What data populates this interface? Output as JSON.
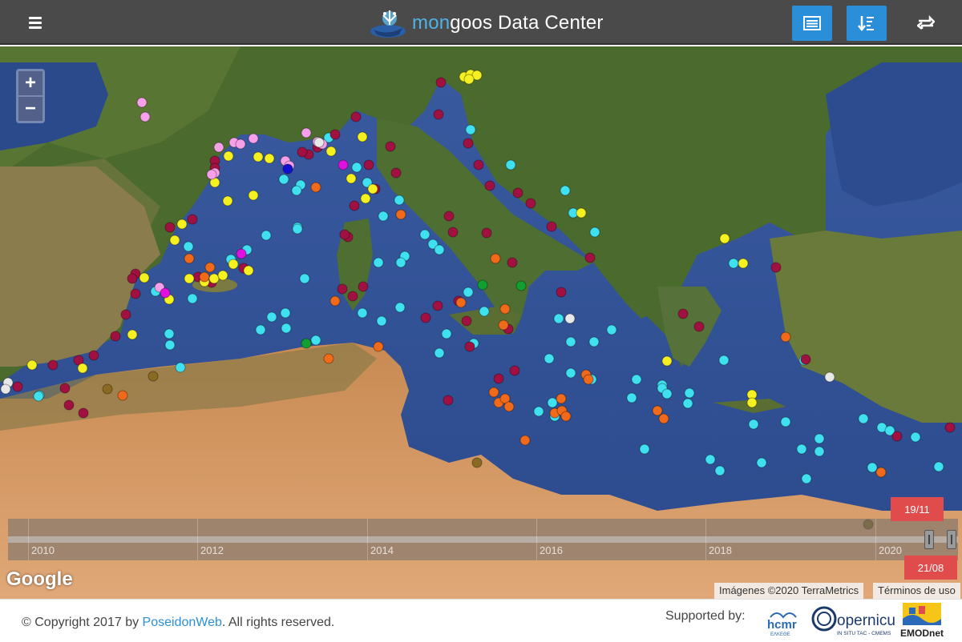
{
  "header": {
    "brand_prefix": "mon",
    "brand_rest": "goos Data Center",
    "menu_icon": "hamburger-icon",
    "btn_list_icon": "list-icon",
    "btn_sort_icon": "sort-icon",
    "btn_swap_icon": "swap-icon",
    "accent": "#2a8fd8"
  },
  "map": {
    "zoom_in": "+",
    "zoom_out": "−",
    "google_logo": "Google",
    "attribution_imagery": "Imágenes ©2020 TerraMetrics",
    "attribution_terms": "Términos de uso"
  },
  "timeline": {
    "years": [
      "2010",
      "2012",
      "2014",
      "2016",
      "2018",
      "2020"
    ],
    "start_flag": "19/11",
    "end_flag": "21/08",
    "flag_color": "#e04b4b"
  },
  "footer": {
    "copyright_prefix": "© Copyright 2017 by ",
    "copyright_link": "PoseidonWeb",
    "copyright_suffix": ". All rights reserved.",
    "supported_by": "Supported by:",
    "logo_hcmr": "hcmr",
    "logo_hcmr_sub": "ΕΛΚΕΘΕ",
    "logo_copernicus": "opernicus",
    "logo_copernicus_sub": "IN SITU TAC - CMEMS",
    "logo_emod": "EMODnet"
  },
  "marker_colors": {
    "cyan": "#3fe0f0",
    "crimson": "#a01040",
    "yellow": "#f5f020",
    "orange": "#f06a1a",
    "pink": "#f5a0e8",
    "magenta": "#e010e0",
    "green": "#10a030",
    "white": "#e8e8e8",
    "olive": "#8a6a20",
    "blue": "#1010d0"
  }
}
